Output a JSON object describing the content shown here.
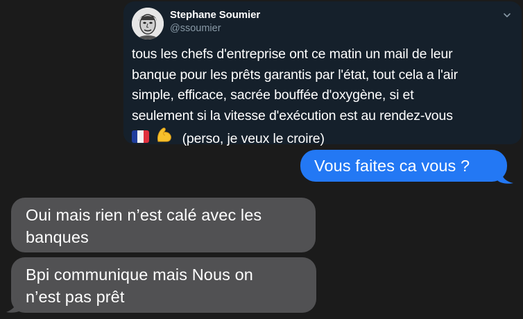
{
  "tweet": {
    "name": "Stephane Soumier",
    "handle": "@ssoumier",
    "lines": [
      "tous les chefs d'entreprise ont ce matin un mail de leur",
      "banque pour les prêts garantis par l'état, tout cela a l'air",
      "simple, efficace, sacrée bouffée d'oxygène, si et",
      "seulement si la vitesse d'exécution est au rendez-vous"
    ],
    "last_line_text": "(perso, je veux le croire)",
    "emojis": [
      "flag-france-icon",
      "flexed-biceps-icon"
    ]
  },
  "messages": {
    "sent": {
      "text": "Vous faites ca vous ?",
      "color": "#2378f4"
    },
    "received": [
      {
        "lines": [
          "Oui mais rien n’est calé avec les",
          "banques"
        ]
      },
      {
        "lines": [
          "Bpi communique mais Nous on",
          "n’est pas prêt"
        ]
      }
    ],
    "received_color": "#515153"
  },
  "colors": {
    "background": "#1b1b1b",
    "tweet_background": "#15202b",
    "handle_gray": "#8899a6"
  }
}
